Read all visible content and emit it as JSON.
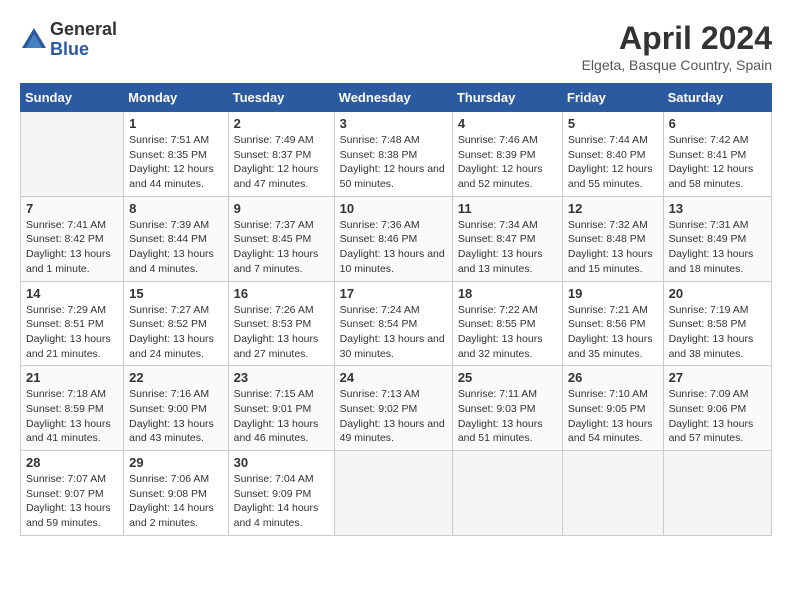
{
  "logo": {
    "general": "General",
    "blue": "Blue"
  },
  "title": "April 2024",
  "subtitle": "Elgeta, Basque Country, Spain",
  "days_header": [
    "Sunday",
    "Monday",
    "Tuesday",
    "Wednesday",
    "Thursday",
    "Friday",
    "Saturday"
  ],
  "weeks": [
    [
      {
        "day": "",
        "sunrise": "",
        "sunset": "",
        "daylight": ""
      },
      {
        "day": "1",
        "sunrise": "Sunrise: 7:51 AM",
        "sunset": "Sunset: 8:35 PM",
        "daylight": "Daylight: 12 hours and 44 minutes."
      },
      {
        "day": "2",
        "sunrise": "Sunrise: 7:49 AM",
        "sunset": "Sunset: 8:37 PM",
        "daylight": "Daylight: 12 hours and 47 minutes."
      },
      {
        "day": "3",
        "sunrise": "Sunrise: 7:48 AM",
        "sunset": "Sunset: 8:38 PM",
        "daylight": "Daylight: 12 hours and 50 minutes."
      },
      {
        "day": "4",
        "sunrise": "Sunrise: 7:46 AM",
        "sunset": "Sunset: 8:39 PM",
        "daylight": "Daylight: 12 hours and 52 minutes."
      },
      {
        "day": "5",
        "sunrise": "Sunrise: 7:44 AM",
        "sunset": "Sunset: 8:40 PM",
        "daylight": "Daylight: 12 hours and 55 minutes."
      },
      {
        "day": "6",
        "sunrise": "Sunrise: 7:42 AM",
        "sunset": "Sunset: 8:41 PM",
        "daylight": "Daylight: 12 hours and 58 minutes."
      }
    ],
    [
      {
        "day": "7",
        "sunrise": "Sunrise: 7:41 AM",
        "sunset": "Sunset: 8:42 PM",
        "daylight": "Daylight: 13 hours and 1 minute."
      },
      {
        "day": "8",
        "sunrise": "Sunrise: 7:39 AM",
        "sunset": "Sunset: 8:44 PM",
        "daylight": "Daylight: 13 hours and 4 minutes."
      },
      {
        "day": "9",
        "sunrise": "Sunrise: 7:37 AM",
        "sunset": "Sunset: 8:45 PM",
        "daylight": "Daylight: 13 hours and 7 minutes."
      },
      {
        "day": "10",
        "sunrise": "Sunrise: 7:36 AM",
        "sunset": "Sunset: 8:46 PM",
        "daylight": "Daylight: 13 hours and 10 minutes."
      },
      {
        "day": "11",
        "sunrise": "Sunrise: 7:34 AM",
        "sunset": "Sunset: 8:47 PM",
        "daylight": "Daylight: 13 hours and 13 minutes."
      },
      {
        "day": "12",
        "sunrise": "Sunrise: 7:32 AM",
        "sunset": "Sunset: 8:48 PM",
        "daylight": "Daylight: 13 hours and 15 minutes."
      },
      {
        "day": "13",
        "sunrise": "Sunrise: 7:31 AM",
        "sunset": "Sunset: 8:49 PM",
        "daylight": "Daylight: 13 hours and 18 minutes."
      }
    ],
    [
      {
        "day": "14",
        "sunrise": "Sunrise: 7:29 AM",
        "sunset": "Sunset: 8:51 PM",
        "daylight": "Daylight: 13 hours and 21 minutes."
      },
      {
        "day": "15",
        "sunrise": "Sunrise: 7:27 AM",
        "sunset": "Sunset: 8:52 PM",
        "daylight": "Daylight: 13 hours and 24 minutes."
      },
      {
        "day": "16",
        "sunrise": "Sunrise: 7:26 AM",
        "sunset": "Sunset: 8:53 PM",
        "daylight": "Daylight: 13 hours and 27 minutes."
      },
      {
        "day": "17",
        "sunrise": "Sunrise: 7:24 AM",
        "sunset": "Sunset: 8:54 PM",
        "daylight": "Daylight: 13 hours and 30 minutes."
      },
      {
        "day": "18",
        "sunrise": "Sunrise: 7:22 AM",
        "sunset": "Sunset: 8:55 PM",
        "daylight": "Daylight: 13 hours and 32 minutes."
      },
      {
        "day": "19",
        "sunrise": "Sunrise: 7:21 AM",
        "sunset": "Sunset: 8:56 PM",
        "daylight": "Daylight: 13 hours and 35 minutes."
      },
      {
        "day": "20",
        "sunrise": "Sunrise: 7:19 AM",
        "sunset": "Sunset: 8:58 PM",
        "daylight": "Daylight: 13 hours and 38 minutes."
      }
    ],
    [
      {
        "day": "21",
        "sunrise": "Sunrise: 7:18 AM",
        "sunset": "Sunset: 8:59 PM",
        "daylight": "Daylight: 13 hours and 41 minutes."
      },
      {
        "day": "22",
        "sunrise": "Sunrise: 7:16 AM",
        "sunset": "Sunset: 9:00 PM",
        "daylight": "Daylight: 13 hours and 43 minutes."
      },
      {
        "day": "23",
        "sunrise": "Sunrise: 7:15 AM",
        "sunset": "Sunset: 9:01 PM",
        "daylight": "Daylight: 13 hours and 46 minutes."
      },
      {
        "day": "24",
        "sunrise": "Sunrise: 7:13 AM",
        "sunset": "Sunset: 9:02 PM",
        "daylight": "Daylight: 13 hours and 49 minutes."
      },
      {
        "day": "25",
        "sunrise": "Sunrise: 7:11 AM",
        "sunset": "Sunset: 9:03 PM",
        "daylight": "Daylight: 13 hours and 51 minutes."
      },
      {
        "day": "26",
        "sunrise": "Sunrise: 7:10 AM",
        "sunset": "Sunset: 9:05 PM",
        "daylight": "Daylight: 13 hours and 54 minutes."
      },
      {
        "day": "27",
        "sunrise": "Sunrise: 7:09 AM",
        "sunset": "Sunset: 9:06 PM",
        "daylight": "Daylight: 13 hours and 57 minutes."
      }
    ],
    [
      {
        "day": "28",
        "sunrise": "Sunrise: 7:07 AM",
        "sunset": "Sunset: 9:07 PM",
        "daylight": "Daylight: 13 hours and 59 minutes."
      },
      {
        "day": "29",
        "sunrise": "Sunrise: 7:06 AM",
        "sunset": "Sunset: 9:08 PM",
        "daylight": "Daylight: 14 hours and 2 minutes."
      },
      {
        "day": "30",
        "sunrise": "Sunrise: 7:04 AM",
        "sunset": "Sunset: 9:09 PM",
        "daylight": "Daylight: 14 hours and 4 minutes."
      },
      {
        "day": "",
        "sunrise": "",
        "sunset": "",
        "daylight": ""
      },
      {
        "day": "",
        "sunrise": "",
        "sunset": "",
        "daylight": ""
      },
      {
        "day": "",
        "sunrise": "",
        "sunset": "",
        "daylight": ""
      },
      {
        "day": "",
        "sunrise": "",
        "sunset": "",
        "daylight": ""
      }
    ]
  ]
}
